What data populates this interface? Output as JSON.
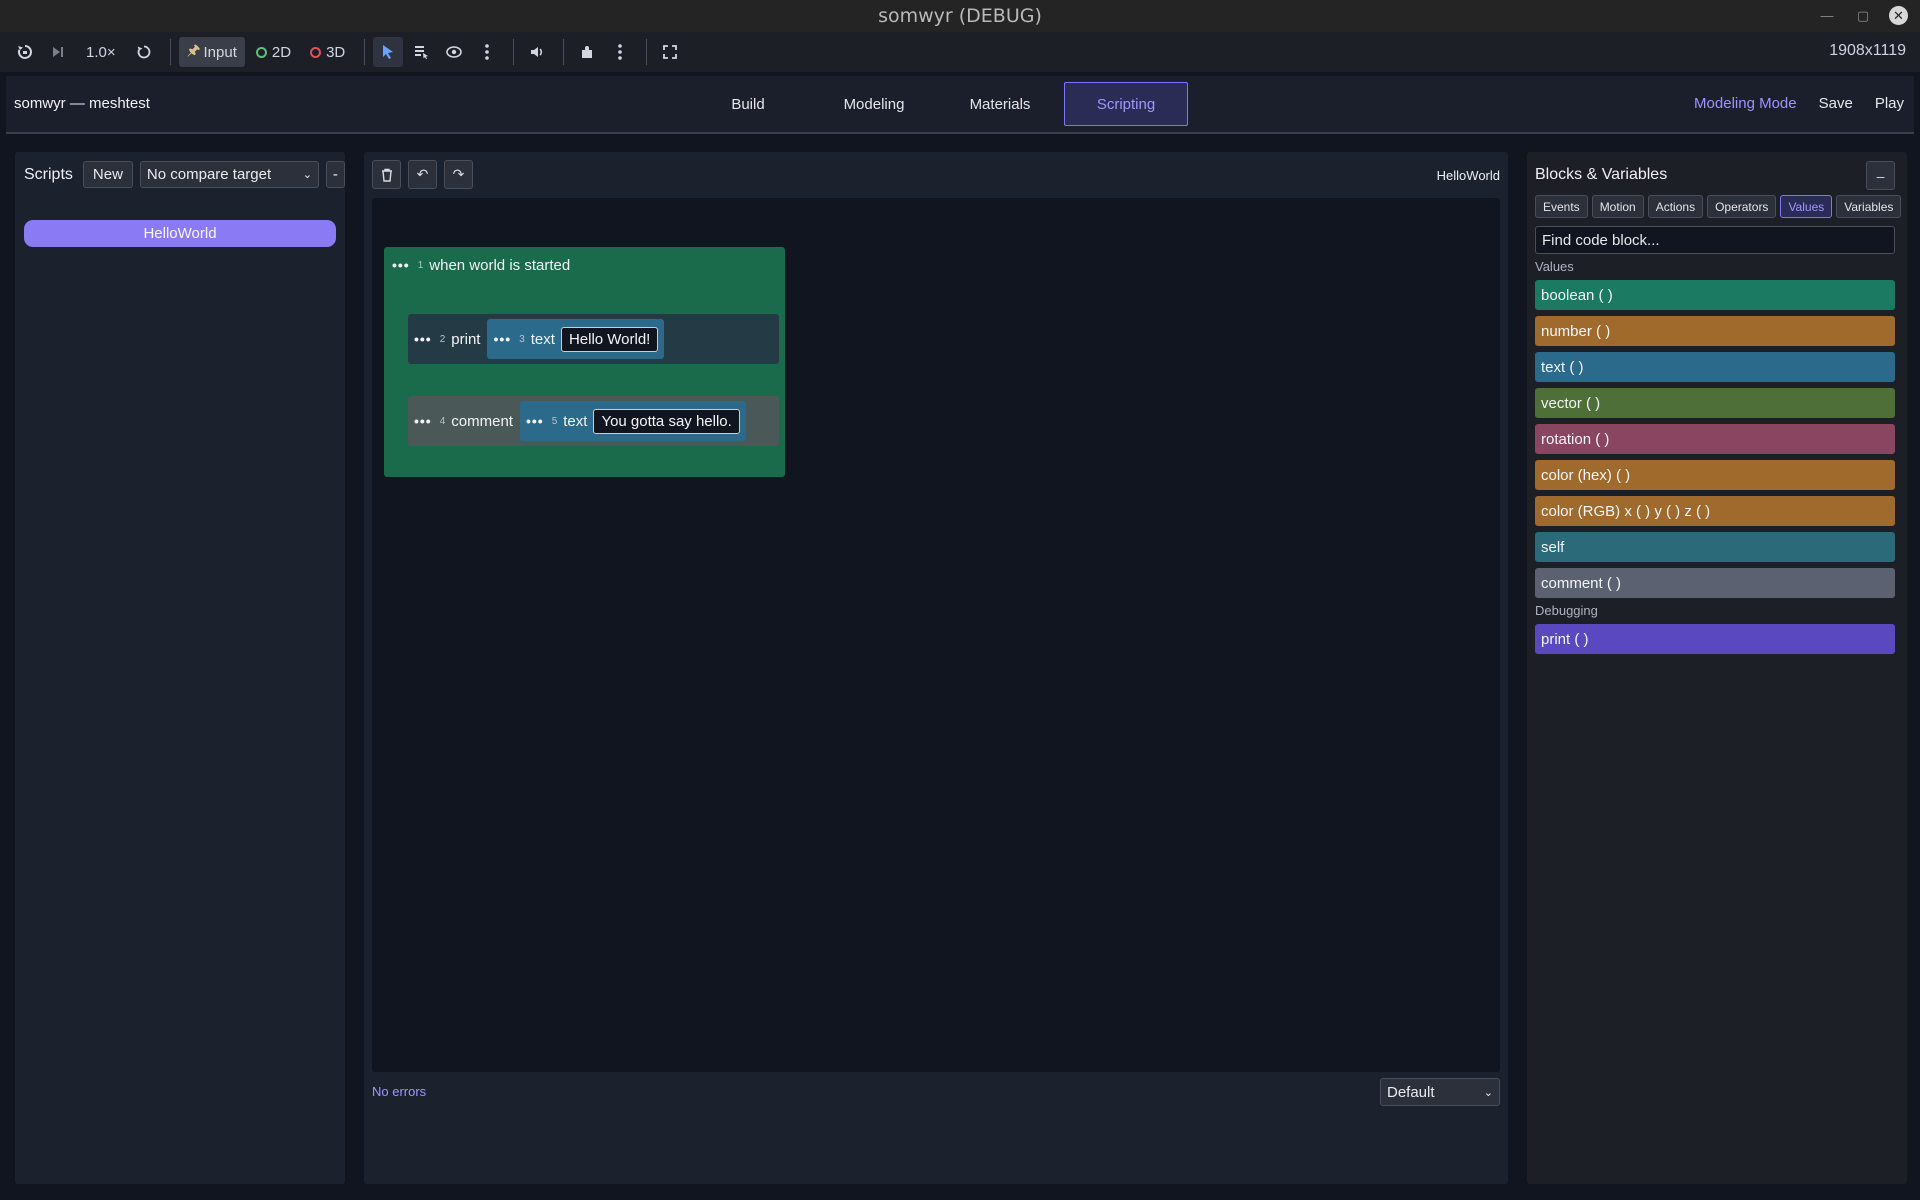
{
  "window": {
    "title": "somwyr (DEBUG)"
  },
  "toolbar": {
    "speed": "1.0×",
    "input_label": "Input",
    "mode_2d": "2D",
    "mode_3d": "3D",
    "resolution": "1908x1119"
  },
  "header": {
    "doc_title": "somwyr — meshtest",
    "tabs": [
      {
        "label": "Build"
      },
      {
        "label": "Modeling"
      },
      {
        "label": "Materials"
      },
      {
        "label": "Scripting"
      }
    ],
    "mode_label": "Modeling Mode",
    "save_label": "Save",
    "play_label": "Play"
  },
  "scripts": {
    "label": "Scripts",
    "new_label": "New",
    "compare_value": "No compare target",
    "remove_label": "-",
    "items": [
      {
        "label": "HelloWorld"
      }
    ]
  },
  "editor": {
    "script_name": "HelloWorld",
    "status": "No errors",
    "mode_value": "Default",
    "blocks": {
      "event": {
        "line": "1",
        "label": "when world is started"
      },
      "print": {
        "line": "2",
        "label": "print"
      },
      "print_text": {
        "line": "3",
        "label": "text",
        "value": "Hello World!"
      },
      "comment": {
        "line": "4",
        "label": "comment"
      },
      "comment_text": {
        "line": "5",
        "label": "text",
        "value": "You gotta say hello."
      }
    }
  },
  "palette": {
    "title": "Blocks & Variables",
    "collapse_label": "–",
    "categories": [
      {
        "label": "Events"
      },
      {
        "label": "Motion"
      },
      {
        "label": "Actions"
      },
      {
        "label": "Operators"
      },
      {
        "label": "Values"
      },
      {
        "label": "Variables"
      }
    ],
    "search_placeholder": "Find code block...",
    "values_heading": "Values",
    "values": [
      {
        "label": "boolean ( )",
        "color": "#1a7a62"
      },
      {
        "label": "number ( )",
        "color": "#a06a2c"
      },
      {
        "label": "text ( )",
        "color": "#2b6a8a"
      },
      {
        "label": "vector ( )",
        "color": "#4f6f38"
      },
      {
        "label": "rotation ( )",
        "color": "#8a4560"
      },
      {
        "label": "color (hex) ( )",
        "color": "#a06a2c"
      },
      {
        "label": "color (RGB) x ( ) y ( ) z ( )",
        "color": "#a06a2c"
      },
      {
        "label": "self",
        "color": "#2b6a78"
      },
      {
        "label": "comment ( )",
        "color": "#5b6170"
      }
    ],
    "debug_heading": "Debugging",
    "debugging": [
      {
        "label": "print ( )",
        "color": "#5a48c0"
      }
    ]
  }
}
